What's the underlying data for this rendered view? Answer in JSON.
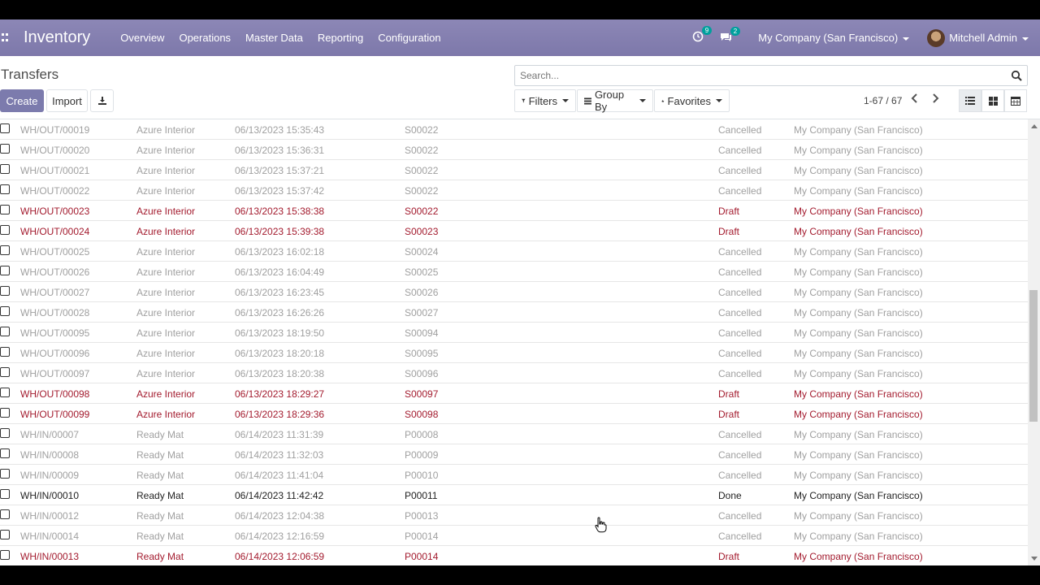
{
  "navbar": {
    "brand": "Inventory",
    "menu": [
      "Overview",
      "Operations",
      "Master Data",
      "Reporting",
      "Configuration"
    ],
    "activity_count": "9",
    "message_count": "2",
    "company": "My Company (San Francisco)",
    "user": "Mitchell Admin"
  },
  "control": {
    "title": "Transfers",
    "create_label": "Create",
    "import_label": "Import",
    "search_placeholder": "Search...",
    "filters_label": "Filters",
    "groupby_label": "Group By",
    "favorites_label": "Favorites",
    "pager": "1-67 / 67"
  },
  "rows": [
    {
      "ref": "WH/OUT/00019",
      "partner": "Azure Interior",
      "date": "06/13/2023 15:35:43",
      "source": "S00022",
      "state": "Cancelled",
      "company": "My Company (San Francisco)"
    },
    {
      "ref": "WH/OUT/00020",
      "partner": "Azure Interior",
      "date": "06/13/2023 15:36:31",
      "source": "S00022",
      "state": "Cancelled",
      "company": "My Company (San Francisco)"
    },
    {
      "ref": "WH/OUT/00021",
      "partner": "Azure Interior",
      "date": "06/13/2023 15:37:21",
      "source": "S00022",
      "state": "Cancelled",
      "company": "My Company (San Francisco)"
    },
    {
      "ref": "WH/OUT/00022",
      "partner": "Azure Interior",
      "date": "06/13/2023 15:37:42",
      "source": "S00022",
      "state": "Cancelled",
      "company": "My Company (San Francisco)"
    },
    {
      "ref": "WH/OUT/00023",
      "partner": "Azure Interior",
      "date": "06/13/2023 15:38:38",
      "source": "S00022",
      "state": "Draft",
      "company": "My Company (San Francisco)"
    },
    {
      "ref": "WH/OUT/00024",
      "partner": "Azure Interior",
      "date": "06/13/2023 15:39:38",
      "source": "S00023",
      "state": "Draft",
      "company": "My Company (San Francisco)"
    },
    {
      "ref": "WH/OUT/00025",
      "partner": "Azure Interior",
      "date": "06/13/2023 16:02:18",
      "source": "S00024",
      "state": "Cancelled",
      "company": "My Company (San Francisco)"
    },
    {
      "ref": "WH/OUT/00026",
      "partner": "Azure Interior",
      "date": "06/13/2023 16:04:49",
      "source": "S00025",
      "state": "Cancelled",
      "company": "My Company (San Francisco)"
    },
    {
      "ref": "WH/OUT/00027",
      "partner": "Azure Interior",
      "date": "06/13/2023 16:23:45",
      "source": "S00026",
      "state": "Cancelled",
      "company": "My Company (San Francisco)"
    },
    {
      "ref": "WH/OUT/00028",
      "partner": "Azure Interior",
      "date": "06/13/2023 16:26:26",
      "source": "S00027",
      "state": "Cancelled",
      "company": "My Company (San Francisco)"
    },
    {
      "ref": "WH/OUT/00095",
      "partner": "Azure Interior",
      "date": "06/13/2023 18:19:50",
      "source": "S00094",
      "state": "Cancelled",
      "company": "My Company (San Francisco)"
    },
    {
      "ref": "WH/OUT/00096",
      "partner": "Azure Interior",
      "date": "06/13/2023 18:20:18",
      "source": "S00095",
      "state": "Cancelled",
      "company": "My Company (San Francisco)"
    },
    {
      "ref": "WH/OUT/00097",
      "partner": "Azure Interior",
      "date": "06/13/2023 18:20:38",
      "source": "S00096",
      "state": "Cancelled",
      "company": "My Company (San Francisco)"
    },
    {
      "ref": "WH/OUT/00098",
      "partner": "Azure Interior",
      "date": "06/13/2023 18:29:27",
      "source": "S00097",
      "state": "Draft",
      "company": "My Company (San Francisco)"
    },
    {
      "ref": "WH/OUT/00099",
      "partner": "Azure Interior",
      "date": "06/13/2023 18:29:36",
      "source": "S00098",
      "state": "Draft",
      "company": "My Company (San Francisco)"
    },
    {
      "ref": "WH/IN/00007",
      "partner": "Ready Mat",
      "date": "06/14/2023 11:31:39",
      "source": "P00008",
      "state": "Cancelled",
      "company": "My Company (San Francisco)"
    },
    {
      "ref": "WH/IN/00008",
      "partner": "Ready Mat",
      "date": "06/14/2023 11:32:03",
      "source": "P00009",
      "state": "Cancelled",
      "company": "My Company (San Francisco)"
    },
    {
      "ref": "WH/IN/00009",
      "partner": "Ready Mat",
      "date": "06/14/2023 11:41:04",
      "source": "P00010",
      "state": "Cancelled",
      "company": "My Company (San Francisco)"
    },
    {
      "ref": "WH/IN/00010",
      "partner": "Ready Mat",
      "date": "06/14/2023 11:42:42",
      "source": "P00011",
      "state": "Done",
      "company": "My Company (San Francisco)"
    },
    {
      "ref": "WH/IN/00012",
      "partner": "Ready Mat",
      "date": "06/14/2023 12:04:38",
      "source": "P00013",
      "state": "Cancelled",
      "company": "My Company (San Francisco)"
    },
    {
      "ref": "WH/IN/00014",
      "partner": "Ready Mat",
      "date": "06/14/2023 12:16:59",
      "source": "P00014",
      "state": "Cancelled",
      "company": "My Company (San Francisco)"
    },
    {
      "ref": "WH/IN/00013",
      "partner": "Ready Mat",
      "date": "06/14/2023 12:06:59",
      "source": "P00014",
      "state": "Draft",
      "company": "My Company (San Francisco)"
    }
  ],
  "colors": {
    "navbar": "#7d78aa",
    "primary": "#7c7bad",
    "draft": "#a31b2e",
    "cancelled": "#a0a0a0"
  }
}
